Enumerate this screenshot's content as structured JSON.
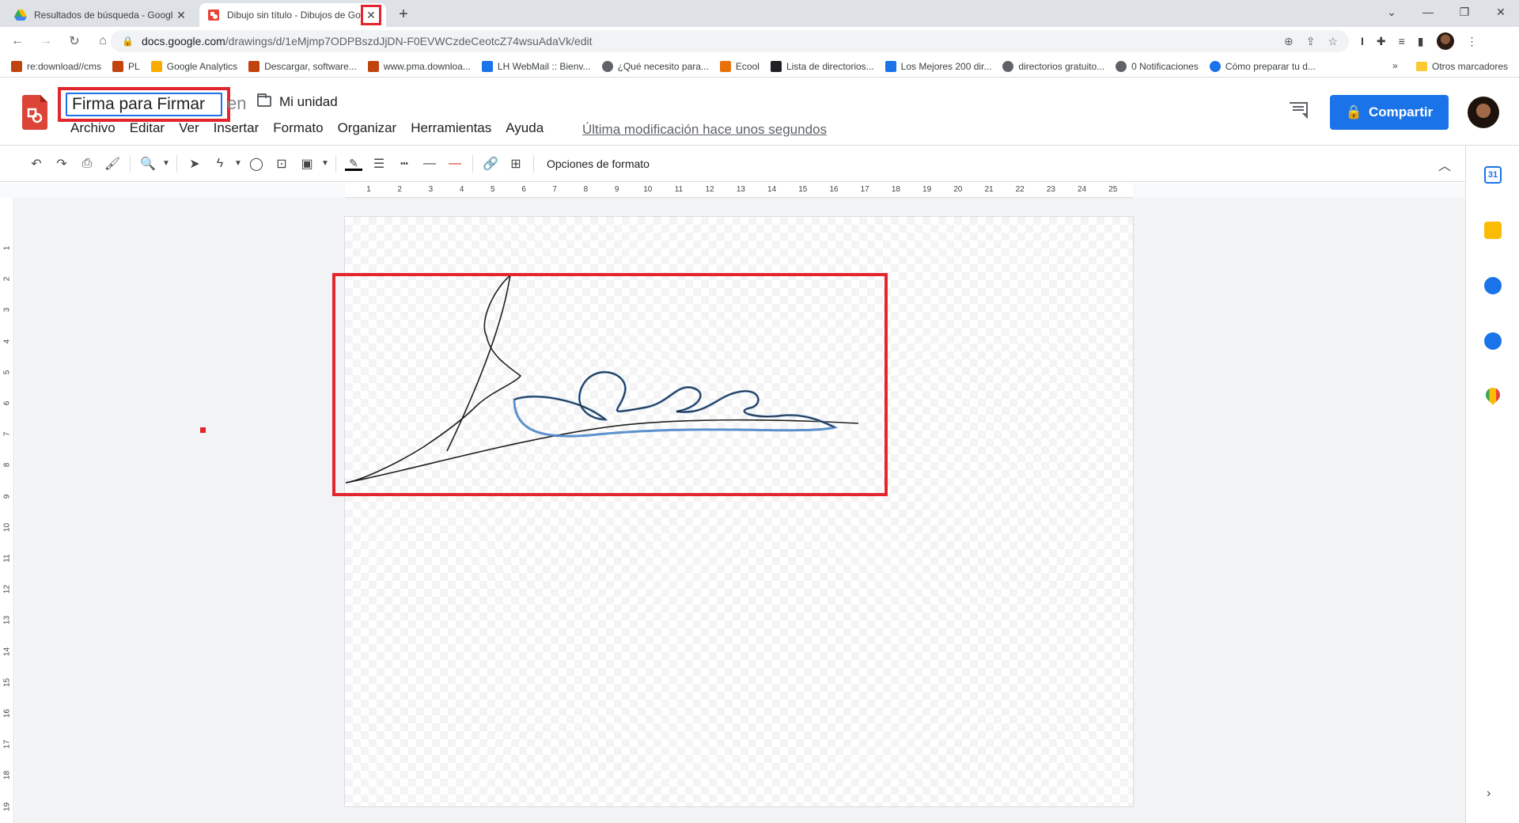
{
  "browser": {
    "tabs": [
      {
        "title": "Resultados de búsqueda - Googl",
        "active": false
      },
      {
        "title": "Dibujo sin título - Dibujos de Go",
        "active": true
      }
    ],
    "new_tab": "+",
    "close_glyph": "✕",
    "url_host": "docs.google.com",
    "url_path": "/drawings/d/1eMjmp7ODPBszdJjDN-F0EVWCzdeCeotcZ74wsuAdaVk/edit",
    "bookmarks": [
      {
        "label": "re:download//cms",
        "color": "#c1440e"
      },
      {
        "label": "PL",
        "color": "#c1440e"
      },
      {
        "label": "Google Analytics",
        "color": "#f9ab00"
      },
      {
        "label": "Descargar, software...",
        "color": "#c1440e"
      },
      {
        "label": "www.pma.downloa...",
        "color": "#c1440e"
      },
      {
        "label": "LH WebMail :: Bienv...",
        "color": "#1a73e8"
      },
      {
        "label": "¿Qué necesito para...",
        "color": "#5f6368"
      },
      {
        "label": "Ecool",
        "color": "#e8710a"
      },
      {
        "label": "Lista de directorios...",
        "color": "#202124"
      },
      {
        "label": "Los Mejores 200 dir...",
        "color": "#1a73e8"
      },
      {
        "label": "directorios gratuito...",
        "color": "#5f6368"
      },
      {
        "label": "0 Notificaciones",
        "color": "#5f6368"
      },
      {
        "label": "Cómo preparar tu d...",
        "color": "#1a73e8"
      }
    ],
    "bookmarks_more": "»",
    "other_bookmarks": "Otros marcadores"
  },
  "app": {
    "doc_title": "Firma para Firmar",
    "location_prefix": "en",
    "location": "Mi unidad",
    "menu": [
      "Archivo",
      "Editar",
      "Ver",
      "Insertar",
      "Formato",
      "Organizar",
      "Herramientas",
      "Ayuda"
    ],
    "last_modified": "Última modificación hace unos segundos",
    "share_label": "Compartir",
    "toolbar_format_options": "Opciones de formato"
  },
  "ruler": {
    "horizontal": [
      "1",
      "2",
      "3",
      "4",
      "5",
      "6",
      "7",
      "8",
      "9",
      "10",
      "11",
      "12",
      "13",
      "14",
      "15",
      "16",
      "17",
      "18",
      "19",
      "20",
      "21",
      "22",
      "23",
      "24",
      "25"
    ],
    "vertical": [
      "1",
      "2",
      "3",
      "4",
      "5",
      "6",
      "7",
      "8",
      "9",
      "10",
      "11",
      "12",
      "13",
      "14",
      "15",
      "16",
      "17",
      "18",
      "19"
    ]
  },
  "colors": {
    "accent": "#1a73e8",
    "highlight": "#e3262e",
    "signature_stroke": "#1f1f1f",
    "selection_stroke": "#4a86c8"
  }
}
